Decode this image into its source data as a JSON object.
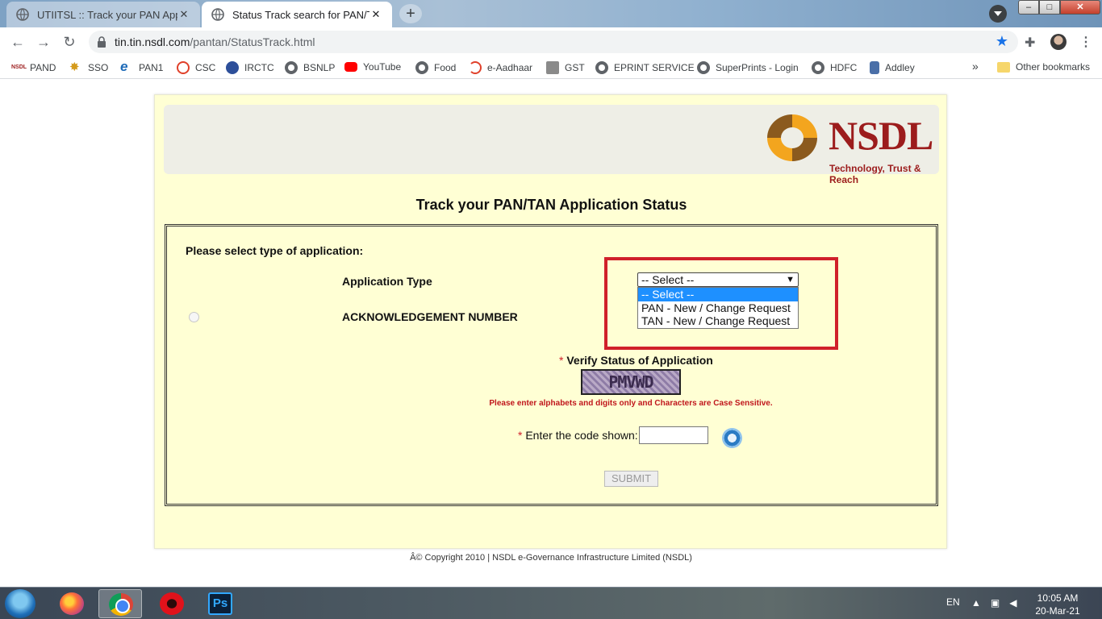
{
  "browser": {
    "tabs": [
      {
        "title": "UTIITSL :: Track your PAN Applica",
        "active": false
      },
      {
        "title": "Status Track search for PAN/TAN",
        "active": true
      }
    ],
    "address": {
      "host": "tin.tin.nsdl.com",
      "path": "/pantan/StatusTrack.html"
    },
    "bookmarks": [
      {
        "label": "PAND",
        "icon": "nsdl-icon"
      },
      {
        "label": "SSO",
        "icon": "star-emblem-icon"
      },
      {
        "label": "PAN1",
        "icon": "ie-icon"
      },
      {
        "label": "CSC",
        "icon": "csc-icon"
      },
      {
        "label": "IRCTC",
        "icon": "irctc-icon"
      },
      {
        "label": "BSNLP",
        "icon": "globe-icon"
      },
      {
        "label": "YouTube",
        "icon": "youtube-icon"
      },
      {
        "label": "Food",
        "icon": "globe-icon"
      },
      {
        "label": "e-Aadhaar",
        "icon": "aadhaar-icon"
      },
      {
        "label": "GST",
        "icon": "emblem-icon"
      },
      {
        "label": "EPRINT SERVICE",
        "icon": "globe-icon"
      },
      {
        "label": "SuperPrints - Login",
        "icon": "globe-icon"
      },
      {
        "label": "HDFC",
        "icon": "globe-icon"
      },
      {
        "label": "Addley",
        "icon": "addley-icon"
      }
    ],
    "overflow": "»",
    "other_bookmarks": "Other bookmarks"
  },
  "page": {
    "logo_text": "NSDL",
    "logo_tagline": "Technology, Trust & Reach",
    "title": "Track your PAN/TAN Application Status",
    "select_type_label": "Please select type of application:",
    "application_type_label": "Application Type",
    "select": {
      "value": "-- Select --",
      "options": [
        "-- Select --",
        "PAN - New / Change Request",
        "TAN - New / Change Request"
      ],
      "highlighted_index": 0
    },
    "ack_label": "ACKNOWLEDGEMENT NUMBER",
    "required_mark": "*",
    "verify_label": "Verify Status of Application",
    "captcha_text": "PMVWD",
    "case_note": "Please enter alphabets and digits only and Characters are Case Sensitive.",
    "code_label": "Enter the code shown:",
    "code_value": "",
    "submit_label": "SUBMIT",
    "copyright": "Â© Copyright 2010  |  NSDL e-Governance Infrastructure Limited (NSDL)"
  },
  "taskbar": {
    "language": "EN",
    "time": "10:05 AM",
    "date": "20-Mar-21",
    "apps": [
      "firefox",
      "chrome",
      "opera",
      "photoshop"
    ],
    "ps_label": "Ps"
  },
  "colors": {
    "page_bg": "#ffffd4",
    "highlight": "#d0202a",
    "brand": "#9c1c1c",
    "accent": "#1a73e8"
  }
}
